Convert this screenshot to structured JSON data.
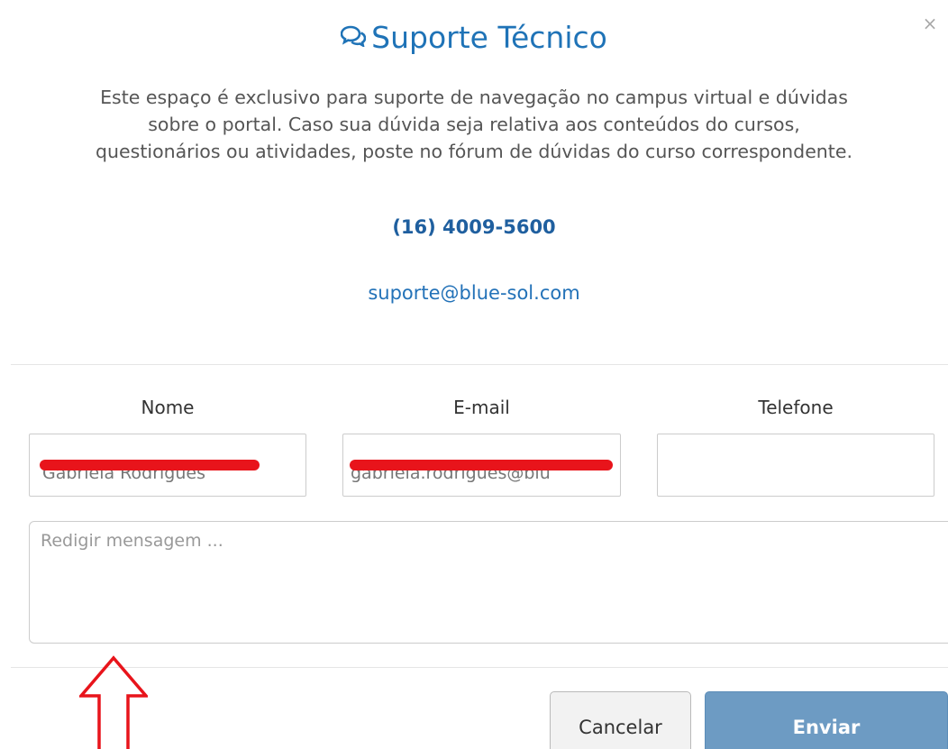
{
  "modal": {
    "title": "Suporte Técnico",
    "close_label": "×",
    "description_lines": [
      "Este espaço é exclusivo para suporte de navegação no campus virtual e dúvidas",
      "sobre o portal. Caso sua dúvida seja relativa aos conteúdos do cursos,",
      "questionários ou atividades, poste no fórum de dúvidas do curso correspondente."
    ],
    "phone": "(16) 4009-5600",
    "email": "suporte@blue-sol.com"
  },
  "form": {
    "name_label": "Nome",
    "email_label": "E-mail",
    "phone_label": "Telefone",
    "name_value": "Gabriela Rodrigues",
    "email_value": "gabriela.rodrigues@blu",
    "phone_value": "",
    "message_placeholder": "Redigir mensagem ..."
  },
  "buttons": {
    "cancel_label": "Cancelar",
    "send_label": "Enviar"
  },
  "icons": {
    "title_icon": "chat-bubbles-icon",
    "annotation": "up-arrow-annotation-icon"
  },
  "colors": {
    "title": "#1f73b7",
    "send_button": "#6d9bc3",
    "annotation": "#e8141b"
  }
}
